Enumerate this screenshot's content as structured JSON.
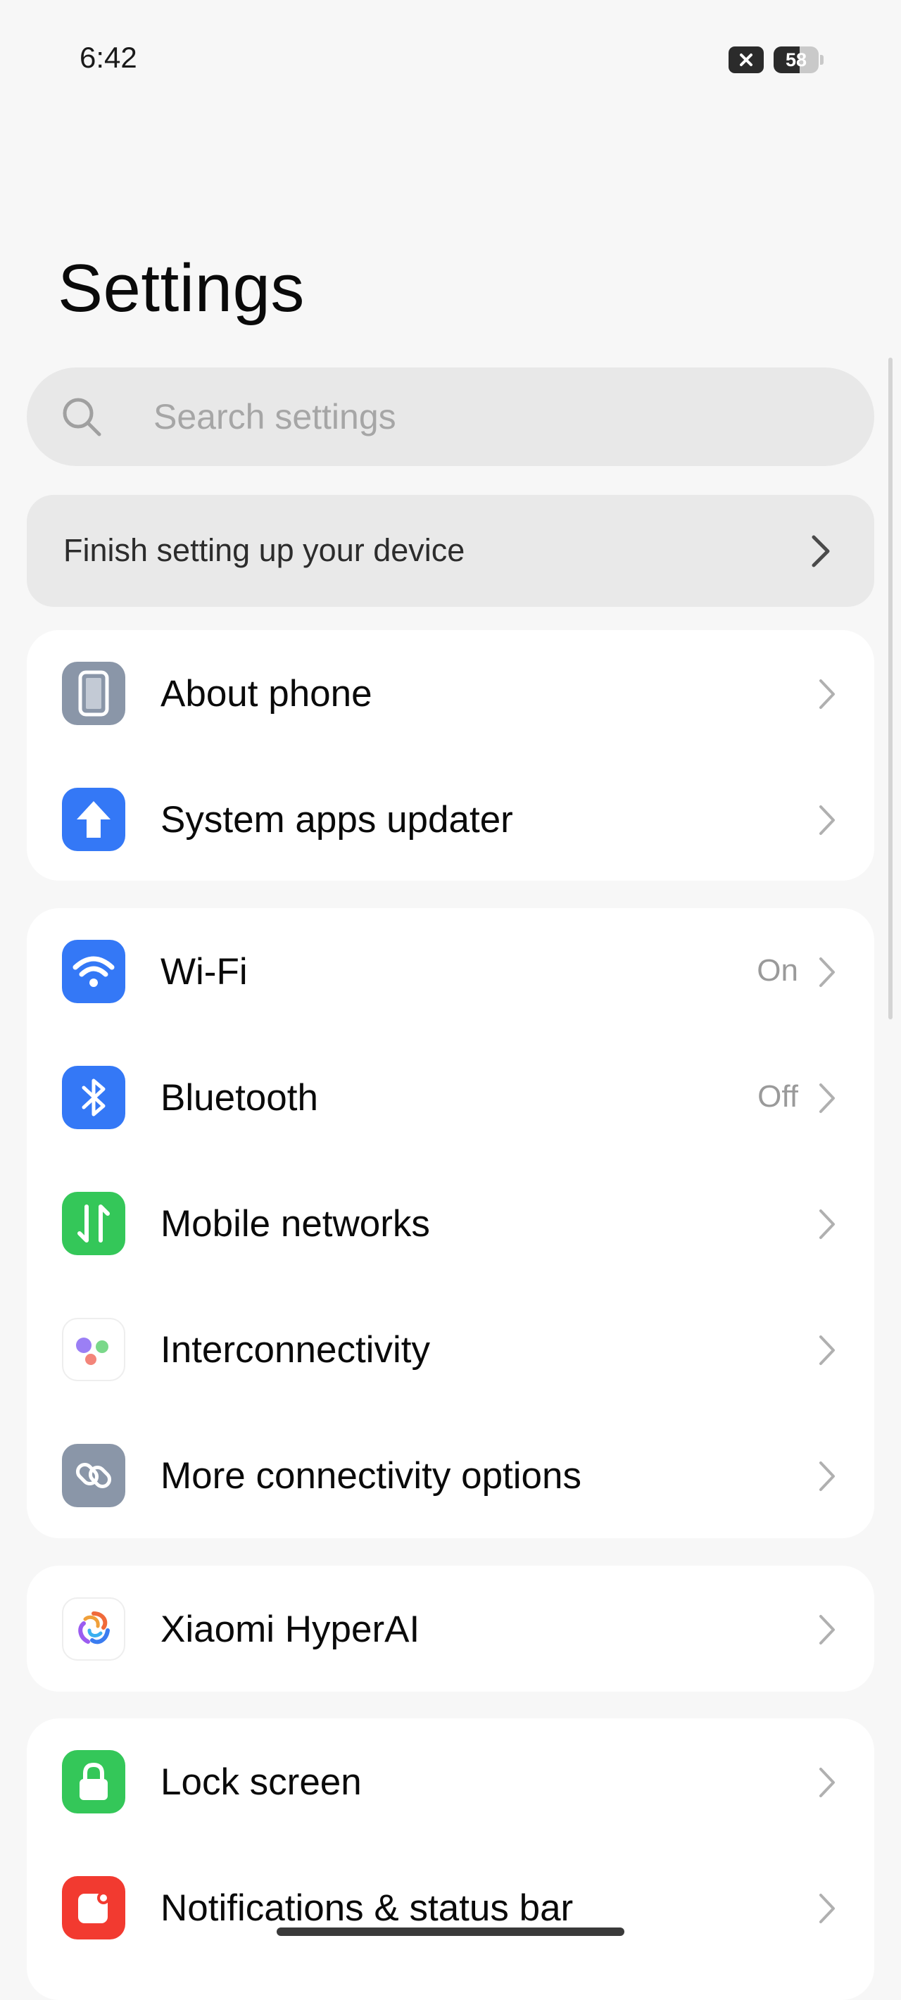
{
  "status_bar": {
    "time": "6:42",
    "battery_level": "58",
    "battery_fraction": 0.58,
    "notification_icon": "close-x-icon"
  },
  "page": {
    "title": "Settings"
  },
  "search": {
    "placeholder": "Search settings",
    "icon": "search-icon"
  },
  "setup_card": {
    "label": "Finish setting up your device",
    "icon": "chevron-right-icon"
  },
  "groups": [
    {
      "items": [
        {
          "label": "About phone",
          "icon": "phone-icon",
          "icon_color": "#8a96a8"
        },
        {
          "label": "System apps updater",
          "icon": "arrow-up-icon",
          "icon_color": "#3478f6"
        }
      ]
    },
    {
      "items": [
        {
          "label": "Wi-Fi",
          "value": "On",
          "icon": "wifi-icon",
          "icon_color": "#3478f6"
        },
        {
          "label": "Bluetooth",
          "value": "Off",
          "icon": "bluetooth-icon",
          "icon_color": "#3478f6"
        },
        {
          "label": "Mobile networks",
          "icon": "mobile-data-icon",
          "icon_color": "#34c759"
        },
        {
          "label": "Interconnectivity",
          "icon": "interconnectivity-icon",
          "icon_color": "#ffffff"
        },
        {
          "label": "More connectivity options",
          "icon": "link-icon",
          "icon_color": "#8a96a8"
        }
      ]
    },
    {
      "items": [
        {
          "label": "Xiaomi HyperAI",
          "icon": "hyperai-icon",
          "icon_color": "#ffffff"
        }
      ]
    },
    {
      "items": [
        {
          "label": "Lock screen",
          "icon": "lock-icon",
          "icon_color": "#34c759"
        },
        {
          "label": "Notifications & status bar",
          "icon": "notification-icon",
          "icon_color": "#f23a30"
        }
      ]
    }
  ]
}
